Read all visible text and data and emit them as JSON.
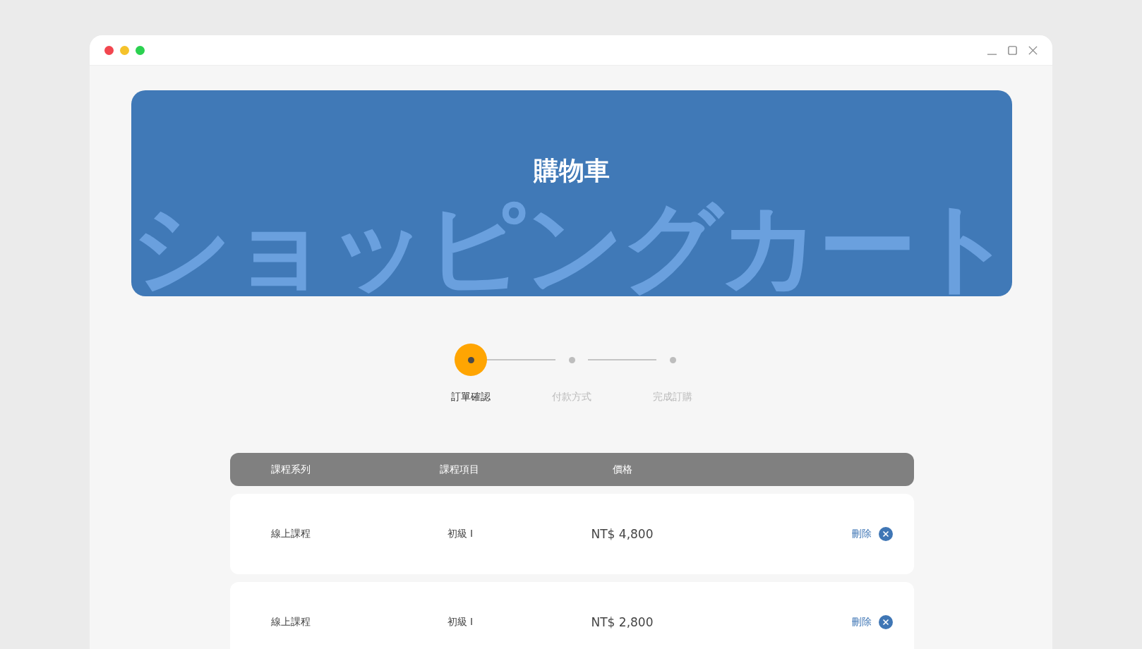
{
  "banner": {
    "title": "購物車",
    "backdrop_text": "ショッピングカート"
  },
  "steps": [
    {
      "label": "訂單確認",
      "selected": true
    },
    {
      "label": "付款方式",
      "selected": false
    },
    {
      "label": "完成訂購",
      "selected": false
    }
  ],
  "table": {
    "columns": [
      "課程系列",
      "課程項目",
      "價格"
    ],
    "rows": [
      {
        "series": "線上課程",
        "item": "初級 I",
        "price": "NT$ 4,800",
        "action": "刪除"
      },
      {
        "series": "線上課程",
        "item": "初級 I",
        "price": "NT$ 2,800",
        "action": "刪除"
      }
    ]
  }
}
